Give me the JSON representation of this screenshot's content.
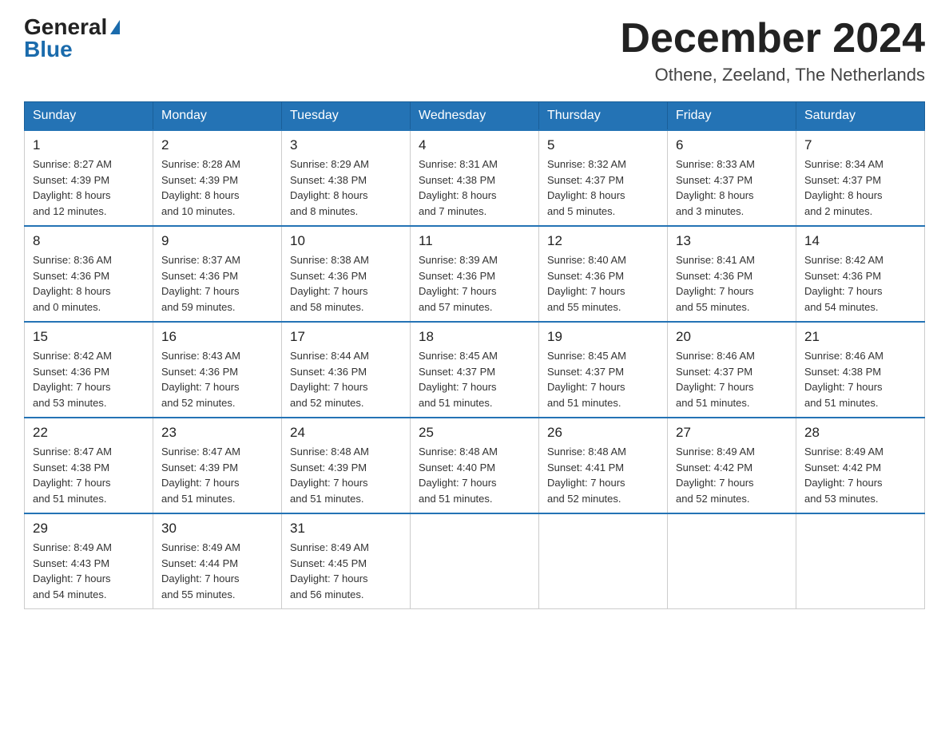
{
  "logo": {
    "general": "General",
    "blue": "Blue"
  },
  "header": {
    "title": "December 2024",
    "subtitle": "Othene, Zeeland, The Netherlands"
  },
  "columns": [
    "Sunday",
    "Monday",
    "Tuesday",
    "Wednesday",
    "Thursday",
    "Friday",
    "Saturday"
  ],
  "weeks": [
    [
      {
        "day": "1",
        "sunrise": "8:27 AM",
        "sunset": "4:39 PM",
        "daylight": "8 hours and 12 minutes."
      },
      {
        "day": "2",
        "sunrise": "8:28 AM",
        "sunset": "4:39 PM",
        "daylight": "8 hours and 10 minutes."
      },
      {
        "day": "3",
        "sunrise": "8:29 AM",
        "sunset": "4:38 PM",
        "daylight": "8 hours and 8 minutes."
      },
      {
        "day": "4",
        "sunrise": "8:31 AM",
        "sunset": "4:38 PM",
        "daylight": "8 hours and 7 minutes."
      },
      {
        "day": "5",
        "sunrise": "8:32 AM",
        "sunset": "4:37 PM",
        "daylight": "8 hours and 5 minutes."
      },
      {
        "day": "6",
        "sunrise": "8:33 AM",
        "sunset": "4:37 PM",
        "daylight": "8 hours and 3 minutes."
      },
      {
        "day": "7",
        "sunrise": "8:34 AM",
        "sunset": "4:37 PM",
        "daylight": "8 hours and 2 minutes."
      }
    ],
    [
      {
        "day": "8",
        "sunrise": "8:36 AM",
        "sunset": "4:36 PM",
        "daylight": "8 hours and 0 minutes."
      },
      {
        "day": "9",
        "sunrise": "8:37 AM",
        "sunset": "4:36 PM",
        "daylight": "7 hours and 59 minutes."
      },
      {
        "day": "10",
        "sunrise": "8:38 AM",
        "sunset": "4:36 PM",
        "daylight": "7 hours and 58 minutes."
      },
      {
        "day": "11",
        "sunrise": "8:39 AM",
        "sunset": "4:36 PM",
        "daylight": "7 hours and 57 minutes."
      },
      {
        "day": "12",
        "sunrise": "8:40 AM",
        "sunset": "4:36 PM",
        "daylight": "7 hours and 55 minutes."
      },
      {
        "day": "13",
        "sunrise": "8:41 AM",
        "sunset": "4:36 PM",
        "daylight": "7 hours and 55 minutes."
      },
      {
        "day": "14",
        "sunrise": "8:42 AM",
        "sunset": "4:36 PM",
        "daylight": "7 hours and 54 minutes."
      }
    ],
    [
      {
        "day": "15",
        "sunrise": "8:42 AM",
        "sunset": "4:36 PM",
        "daylight": "7 hours and 53 minutes."
      },
      {
        "day": "16",
        "sunrise": "8:43 AM",
        "sunset": "4:36 PM",
        "daylight": "7 hours and 52 minutes."
      },
      {
        "day": "17",
        "sunrise": "8:44 AM",
        "sunset": "4:36 PM",
        "daylight": "7 hours and 52 minutes."
      },
      {
        "day": "18",
        "sunrise": "8:45 AM",
        "sunset": "4:37 PM",
        "daylight": "7 hours and 51 minutes."
      },
      {
        "day": "19",
        "sunrise": "8:45 AM",
        "sunset": "4:37 PM",
        "daylight": "7 hours and 51 minutes."
      },
      {
        "day": "20",
        "sunrise": "8:46 AM",
        "sunset": "4:37 PM",
        "daylight": "7 hours and 51 minutes."
      },
      {
        "day": "21",
        "sunrise": "8:46 AM",
        "sunset": "4:38 PM",
        "daylight": "7 hours and 51 minutes."
      }
    ],
    [
      {
        "day": "22",
        "sunrise": "8:47 AM",
        "sunset": "4:38 PM",
        "daylight": "7 hours and 51 minutes."
      },
      {
        "day": "23",
        "sunrise": "8:47 AM",
        "sunset": "4:39 PM",
        "daylight": "7 hours and 51 minutes."
      },
      {
        "day": "24",
        "sunrise": "8:48 AM",
        "sunset": "4:39 PM",
        "daylight": "7 hours and 51 minutes."
      },
      {
        "day": "25",
        "sunrise": "8:48 AM",
        "sunset": "4:40 PM",
        "daylight": "7 hours and 51 minutes."
      },
      {
        "day": "26",
        "sunrise": "8:48 AM",
        "sunset": "4:41 PM",
        "daylight": "7 hours and 52 minutes."
      },
      {
        "day": "27",
        "sunrise": "8:49 AM",
        "sunset": "4:42 PM",
        "daylight": "7 hours and 52 minutes."
      },
      {
        "day": "28",
        "sunrise": "8:49 AM",
        "sunset": "4:42 PM",
        "daylight": "7 hours and 53 minutes."
      }
    ],
    [
      {
        "day": "29",
        "sunrise": "8:49 AM",
        "sunset": "4:43 PM",
        "daylight": "7 hours and 54 minutes."
      },
      {
        "day": "30",
        "sunrise": "8:49 AM",
        "sunset": "4:44 PM",
        "daylight": "7 hours and 55 minutes."
      },
      {
        "day": "31",
        "sunrise": "8:49 AM",
        "sunset": "4:45 PM",
        "daylight": "7 hours and 56 minutes."
      },
      null,
      null,
      null,
      null
    ]
  ],
  "labels": {
    "sunrise": "Sunrise:",
    "sunset": "Sunset:",
    "daylight": "Daylight:"
  }
}
